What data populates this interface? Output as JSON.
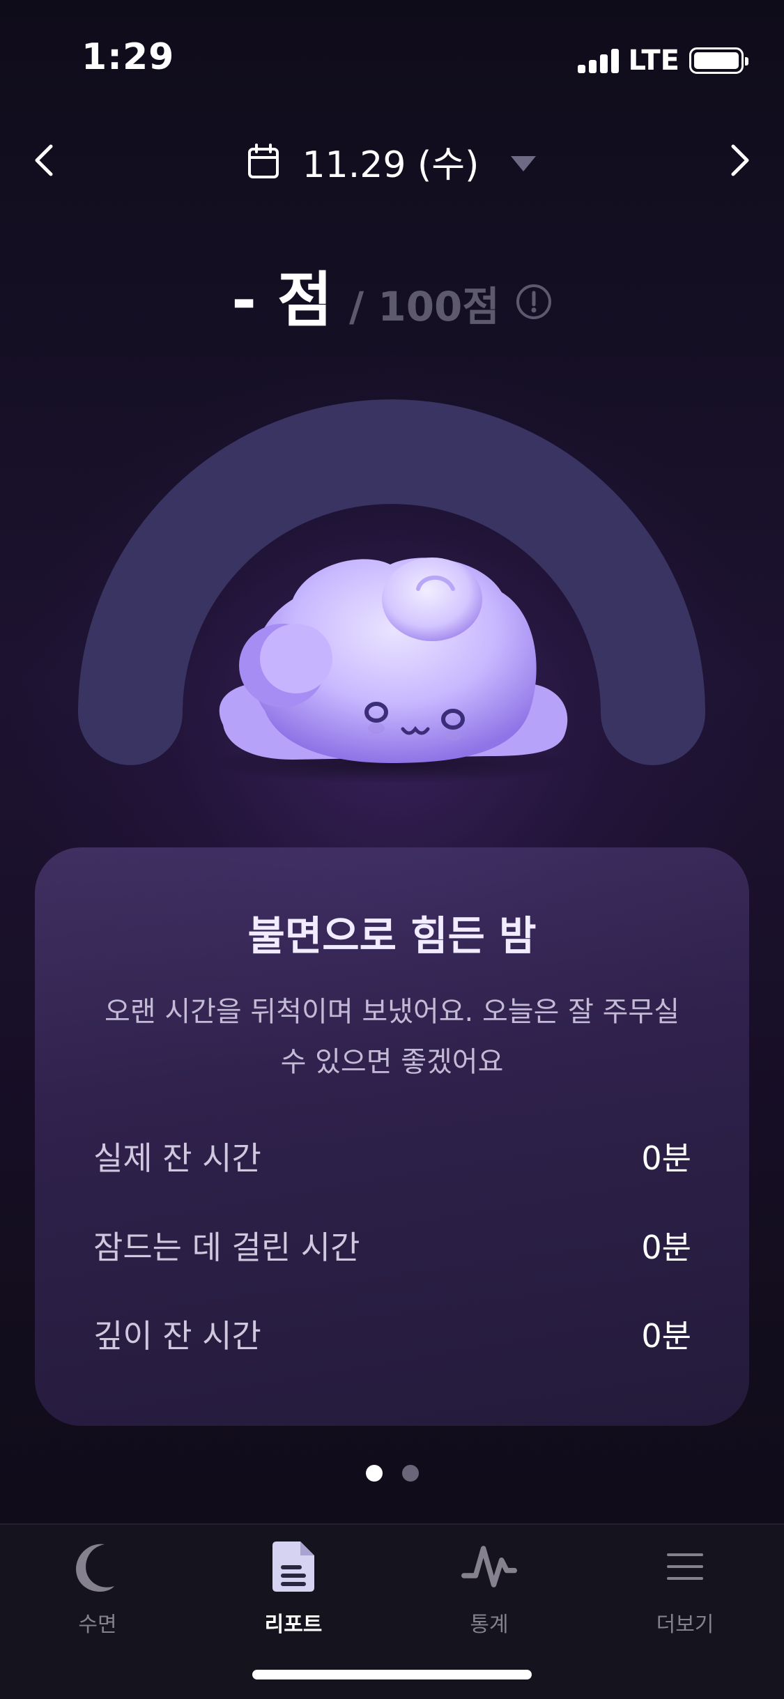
{
  "status_bar": {
    "time": "1:29",
    "network": "LTE",
    "battery_level": 1.0
  },
  "header": {
    "date": "11.29 (수)",
    "prev_icon": "chevron-left-icon",
    "next_icon": "chevron-right-icon",
    "calendar_icon": "calendar-icon",
    "dropdown_icon": "caret-down-icon"
  },
  "score": {
    "value": "- 점",
    "max": "/ 100점",
    "info_icon": "info-icon"
  },
  "card": {
    "title": "불면으로 힘든 밤",
    "description": "오랜 시간을 뒤척이며 보냈어요. 오늘은 잘 주무실 수 있으면 좋겠어요",
    "stats": [
      {
        "label": "실제 잔 시간",
        "value": "0분"
      },
      {
        "label": "잠드는 데 걸린 시간",
        "value": "0분"
      },
      {
        "label": "깊이 잔 시간",
        "value": "0분"
      }
    ]
  },
  "pager": {
    "pages": 2,
    "current": 1
  },
  "tabs": [
    {
      "label": "수면",
      "icon": "moon-icon",
      "active": false
    },
    {
      "label": "리포트",
      "icon": "document-icon",
      "active": true
    },
    {
      "label": "통계",
      "icon": "pulse-icon",
      "active": false
    },
    {
      "label": "더보기",
      "icon": "menu-icon",
      "active": false
    }
  ],
  "colors": {
    "background": "#150f24",
    "card": "#3e2f60",
    "arch": "#3a3463",
    "mascot": "#c9b8ff",
    "muted_text": "#5e5a6e",
    "tab_inactive": "#85818f"
  }
}
